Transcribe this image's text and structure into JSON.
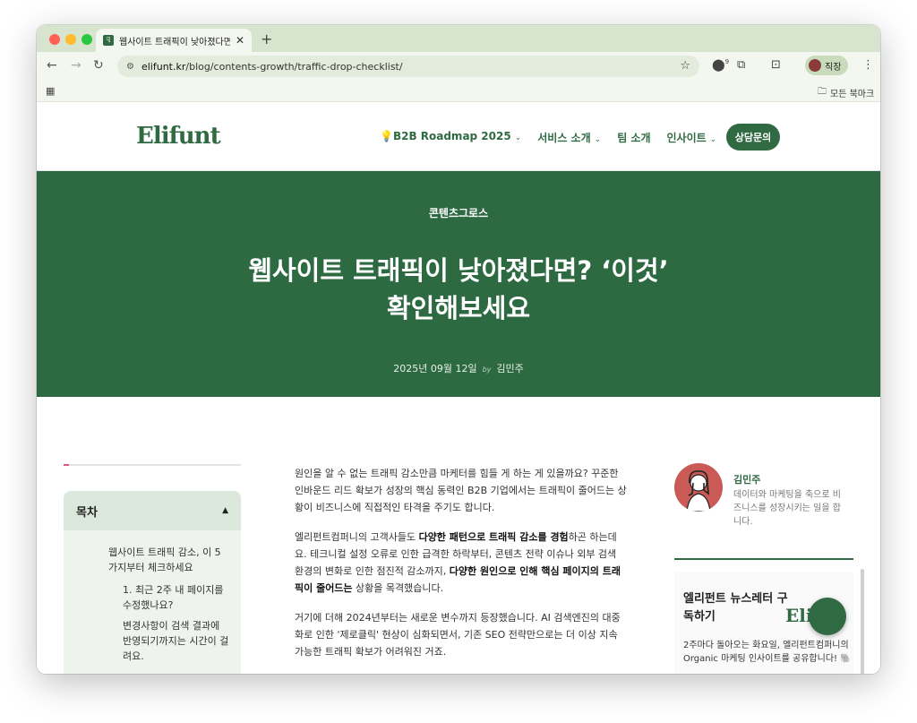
{
  "browser": {
    "tab_title": "웹사이트 트래픽이 낮아졌다면? '이",
    "url_host": "elifunt.kr",
    "url_path": "/blog/contents-growth/traffic-drop-checklist/",
    "profile_label": "직장",
    "extension_badge": "9",
    "bookmark_folder": "모든 북마크",
    "tab_favicon_text": "ꟻ"
  },
  "site": {
    "logo": "Elifunt",
    "nav": [
      {
        "label": "💡B2B Roadmap 2025",
        "caret": true
      },
      {
        "label": "서비스 소개",
        "caret": true
      },
      {
        "label": "팀 소개",
        "caret": false
      },
      {
        "label": "인사이트",
        "caret": true
      }
    ],
    "cta": "상담문의"
  },
  "hero": {
    "category": "콘텐츠그로스",
    "title_line1": "웹사이트 트래픽이 낮아졌다면? ‘이것’",
    "title_line2": "확인해보세요",
    "date": "2025년 09월 12일",
    "by": "by",
    "author": "김민주"
  },
  "toc": {
    "title": "목차",
    "items": [
      "웹사이트 트래픽 감소, 이 5가지부터 체크하세요",
      "1. 최근 2주 내 페이지를 수정했나요?",
      "변경사항이 검색 결과에 반영되기까지는 시간이 걸려요."
    ]
  },
  "article": {
    "p1": "원인을 알 수 없는 트래픽 감소만큼 마케터를 힘들 게 하는 게 있을까요? 꾸준한 인바운드 리드 확보가 성장의 핵심 동력인 B2B 기업에서는 트래픽이 줄어드는 상황이 비즈니스에 직접적인 타격을 주기도 합니다.",
    "p2_a": "엘리펀트컴퍼니의 고객사들도 ",
    "p2_b": "다양한 패턴으로 트래픽 감소를 경험",
    "p2_c": "하곤 하는데요. 테크니컬 설정 오류로 인한 급격한 하락부터, 콘텐츠 전략 이슈나 외부 검색 환경의 변화로 인한 점진적 감소까지, ",
    "p2_d": "다양한 원인으로 인해 핵심 페이지의 트래픽이 줄어드는",
    "p2_e": " 상황을 목격했습니다.",
    "p3": "거기에 더해 2024년부터는 새로운 변수까지 등장했습니다. AI 검색엔진의 대중화로 인한 '제로클릭' 현상이 심화되면서, 기존 SEO 전략만으로는 더 이상 지속 가능한 트래픽 확보가 어려워진 거죠."
  },
  "author_card": {
    "name": "김민주",
    "bio": "데이터와 마케팅을 축으로 비즈니스를 성장시키는 일을 합니다."
  },
  "newsletter": {
    "title": "엘리펀트 뉴스레터 구독하기",
    "desc": "2주마다 돌아오는 화요일, 엘리펀트컴퍼니의 Organic 마케팅 인사이트를 공유합니다! 🐘",
    "badge_text": "Eli"
  },
  "colors": {
    "brand_green": "#2f6a43",
    "hero_bg": "#2d6a42",
    "accent_pink": "#e0587a"
  }
}
